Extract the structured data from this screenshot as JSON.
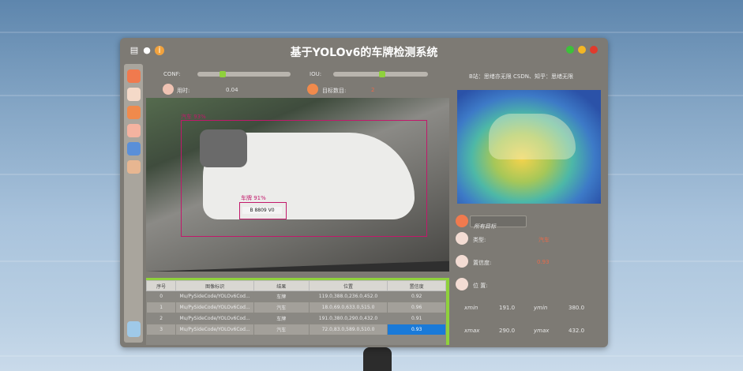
{
  "window": {
    "title": "基于YOLOv6的车牌检测系统",
    "buttons": [
      {
        "name": "close-dot",
        "color": "#e03a2c"
      },
      {
        "name": "minimize-dot",
        "color": "#f3b624"
      },
      {
        "name": "maximize-dot",
        "color": "#3cc13a"
      }
    ]
  },
  "controls": {
    "conf_label": "CONF:",
    "conf_value": 0.25,
    "iou_label": "IOU:",
    "iou_value": 0.45,
    "time_label": "用时:",
    "time_value": "0.04",
    "count_label": "目标数目:",
    "count_value": "2",
    "credit": "B站：思绪亦无限 CSDN、知乎：思绪无限"
  },
  "detections": [
    {
      "label": "汽车 93%"
    },
    {
      "label": "车牌 91%"
    }
  ],
  "plate_text": "B 8809 V0",
  "table": {
    "headers": [
      "序号",
      "图像标识",
      "结果",
      "位置",
      "置信度"
    ],
    "rows": [
      [
        "0",
        "Mu/PySideCode/YOLOv6Cod...",
        "车牌",
        "119.0,388.0,236.0,452.0",
        "0.92"
      ],
      [
        "1",
        "Mu/PySideCode/YOLOv6Cod...",
        "汽车",
        "18.0,69.0,633.0,515.0",
        "0.96"
      ],
      [
        "2",
        "Mu/PySideCode/YOLOv6Cod...",
        "车牌",
        "191.0,380.0,290.0,432.0",
        "0.91"
      ],
      [
        "3",
        "Mu/PySideCode/YOLOv6Cod...",
        "汽车",
        "72.0,83.0,589.0,510.0",
        "0.93"
      ]
    ]
  },
  "panel": {
    "dropdown": "所有目标",
    "class_label": "类型:",
    "class_value": "汽车",
    "conf_label": "置信度:",
    "conf_value": "0.93",
    "pos_label": "位 置:",
    "xmin_label": "xmin",
    "xmin_value": "191.0",
    "ymin_label": "ymin",
    "ymin_value": "380.0",
    "xmax_label": "xmax",
    "xmax_value": "290.0",
    "ymax_label": "ymax",
    "ymax_value": "432.0"
  }
}
